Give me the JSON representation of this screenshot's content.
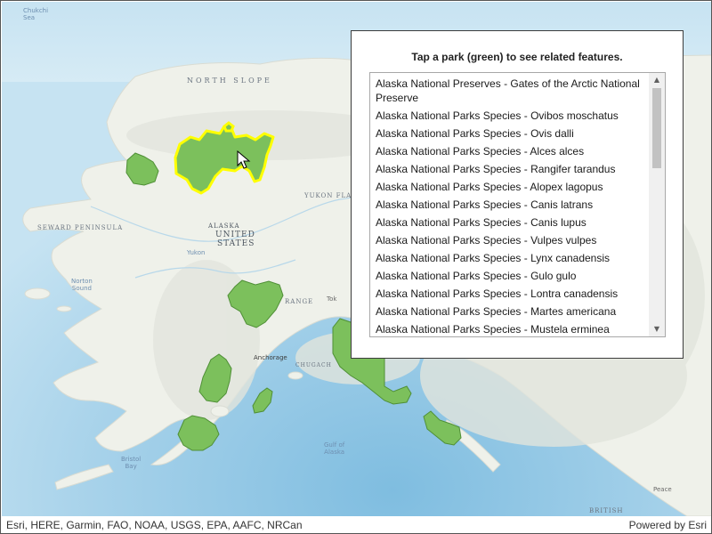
{
  "map": {
    "labels": {
      "north_slope": "NORTH SLOPE",
      "alaska": "ALASKA",
      "united": "UNITED",
      "states": "STATES",
      "yukon_flats": "YUKON FLA",
      "seward": "SEWARD PENINSULA",
      "norton1": "Norton",
      "norton2": "Sound",
      "anchorage": "Anchorage",
      "chugach": "CHUGACH",
      "gulf1": "Gulf of",
      "gulf2": "Alaska",
      "bristol1": "Bristol",
      "bristol2": "Bay",
      "chukchi1": "Chukchi",
      "chukchi2": "Sea",
      "yukon_river": "Yukon",
      "range": "RANGE",
      "bc": "BRITISH",
      "tok": "Tok",
      "peace": "Peace"
    },
    "colors": {
      "park_fill": "#7cc05c",
      "park_stroke": "#4f8f36",
      "selected_outline": "#ffff00",
      "ocean": "#a9d3ea",
      "land": "#eef1ea"
    },
    "selected_park_index": 0
  },
  "panel": {
    "title": "Tap a park (green) to see related features.",
    "items": [
      "Alaska National Preserves - Gates of the Arctic National Preserve",
      "Alaska National Parks Species - Ovibos moschatus",
      "Alaska National Parks Species - Ovis dalli",
      "Alaska National Parks Species - Alces alces",
      "Alaska National Parks Species - Rangifer tarandus",
      "Alaska National Parks Species - Alopex lagopus",
      "Alaska National Parks Species - Canis latrans",
      "Alaska National Parks Species - Canis lupus",
      "Alaska National Parks Species - Vulpes vulpes",
      "Alaska National Parks Species - Lynx canadensis",
      "Alaska National Parks Species - Gulo gulo",
      "Alaska National Parks Species - Lontra canadensis",
      "Alaska National Parks Species - Martes americana",
      "Alaska National Parks Species - Mustela erminea"
    ],
    "scroll_up_icon": "chevron-up-icon",
    "scroll_down_icon": "chevron-down-icon"
  },
  "footer": {
    "attribution": "Esri, HERE, Garmin, FAO, NOAA, USGS, EPA, AAFC, NRCan",
    "powered_by": "Powered by Esri"
  },
  "cursor_icon": "pointer-arrow-icon"
}
